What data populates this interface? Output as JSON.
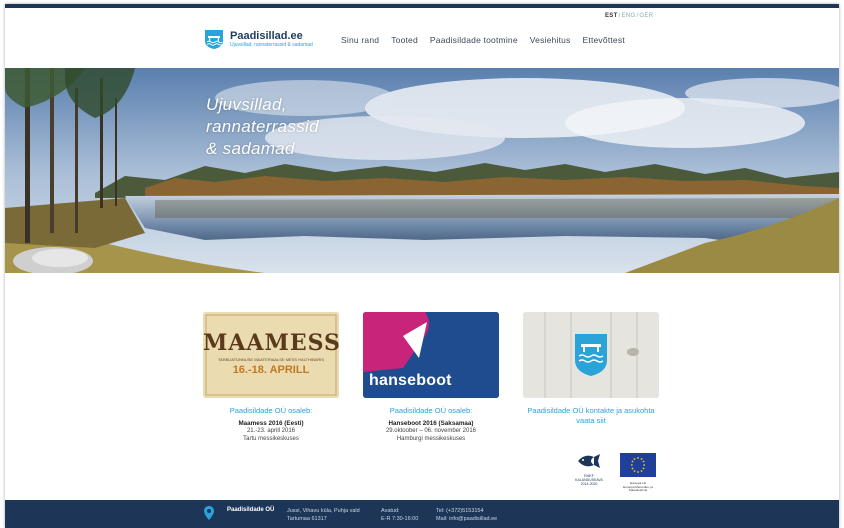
{
  "language": {
    "items": [
      "EST",
      "ENG",
      "GER"
    ],
    "active": "EST"
  },
  "brand": {
    "name": "Paadisillad.ee",
    "tagline": "Ujuvsillad, rannaterrassid & sadamad"
  },
  "nav": {
    "items": [
      "Sinu rand",
      "Tooted",
      "Paadisildade tootmine",
      "Vesiehitus",
      "Ettevõttest"
    ]
  },
  "hero": {
    "lines": [
      "Ujuvsillad,",
      "rannaterrassid",
      "& sadamad"
    ]
  },
  "cards": [
    {
      "image_text": {
        "title": "MAAMESS",
        "subtitle": "TARBIJATUNNUSE MAATERIAALSE MESS HALTHIBARIS",
        "dates": "16.-18. APRILL"
      },
      "heading": "Paadisildade OÜ osaleb:",
      "bold": "Maamess 2016 (Eesti)",
      "lines": [
        "21.-23. aprill 2016",
        "Tartu messikeskuses"
      ]
    },
    {
      "image_text": {
        "title": "hanseboot"
      },
      "heading": "Paadisildade OÜ osaleb:",
      "bold": "Hanseboot 2016 (Saksamaa)",
      "lines": [
        "29.oktoober – 06. november 2016",
        "Hamburgi messikeskuses"
      ]
    },
    {
      "image_text": {},
      "heading": "Paadisildade OÜ kontakte ja asukohta vaata siit",
      "bold": "",
      "lines": []
    }
  ],
  "badges": {
    "eafp": {
      "lines": [
        "EMKF",
        "KALANDUSKAVA",
        "2014-2020"
      ]
    },
    "eu": {
      "lines": [
        "Euroopa Liit",
        "Euroopa Merendus- ja Kalandusfond"
      ]
    }
  },
  "footer": {
    "company": "Paadisildade OÜ",
    "address": [
      "Jussi, Vihavu küla, Puhja vald",
      "Tartumaa 61317"
    ],
    "hours": [
      "Avatud:",
      "E-R 7:30-16:00"
    ],
    "contact": [
      "Tel: (+372)5153154",
      "Mail: info@paadisillad.ee"
    ]
  },
  "colors": {
    "navy": "#1d3557",
    "accent": "#29a3d8"
  }
}
